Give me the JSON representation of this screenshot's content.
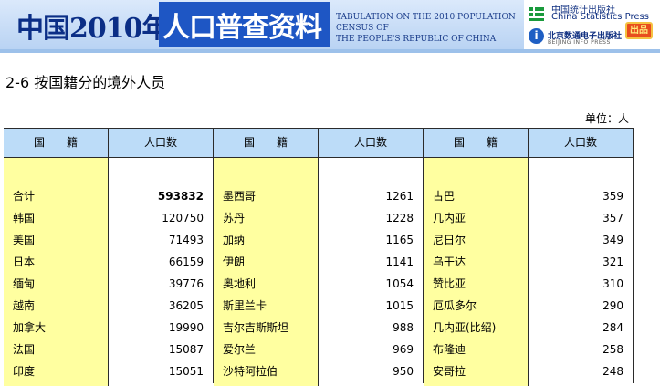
{
  "banner": {
    "title_main": "中国2010年",
    "title_sub": "人口普查资料",
    "title_en_1": "TABULATION ON THE 2010 POPULATION CENSUS OF",
    "title_en_2": "THE PEOPLE'S REPUBLIC OF CHINA",
    "publisher_cn": "中国统计出版社",
    "publisher_en": "China Statistics Press",
    "digital_cn": "北京数通电子出版社",
    "digital_en": "BEIJING INFO PRESS",
    "badge": "出品"
  },
  "page": {
    "table_title": "2-6  按国籍分的境外人员",
    "unit": "单位：人"
  },
  "table": {
    "header_name": "国　　籍",
    "header_pop": "人口数",
    "groups": [
      {
        "rows": [
          {
            "name": "合计",
            "value": "593832"
          },
          {
            "name": "韩国",
            "value": "120750"
          },
          {
            "name": "美国",
            "value": "71493"
          },
          {
            "name": "日本",
            "value": "66159"
          },
          {
            "name": "缅甸",
            "value": "39776"
          },
          {
            "name": "越南",
            "value": "36205"
          },
          {
            "name": "加拿大",
            "value": "19990"
          },
          {
            "name": "法国",
            "value": "15087"
          },
          {
            "name": "印度",
            "value": "15051"
          }
        ]
      },
      {
        "rows": [
          {
            "name": "墨西哥",
            "value": "1261"
          },
          {
            "name": "苏丹",
            "value": "1228"
          },
          {
            "name": "加纳",
            "value": "1165"
          },
          {
            "name": "伊朗",
            "value": "1141"
          },
          {
            "name": "奥地利",
            "value": "1054"
          },
          {
            "name": "斯里兰卡",
            "value": "1015"
          },
          {
            "name": "吉尔吉斯斯坦",
            "value": "988"
          },
          {
            "name": "爱尔兰",
            "value": "969"
          },
          {
            "name": "沙特阿拉伯",
            "value": "950"
          }
        ]
      },
      {
        "rows": [
          {
            "name": "古巴",
            "value": "359"
          },
          {
            "name": "几内亚",
            "value": "357"
          },
          {
            "name": "尼日尔",
            "value": "349"
          },
          {
            "name": "乌干达",
            "value": "321"
          },
          {
            "name": "赞比亚",
            "value": "310"
          },
          {
            "name": "厄瓜多尔",
            "value": "290"
          },
          {
            "name": "几内亚(比绍)",
            "value": "284"
          },
          {
            "name": "布隆迪",
            "value": "258"
          },
          {
            "name": "安哥拉",
            "value": "248"
          }
        ]
      }
    ]
  }
}
